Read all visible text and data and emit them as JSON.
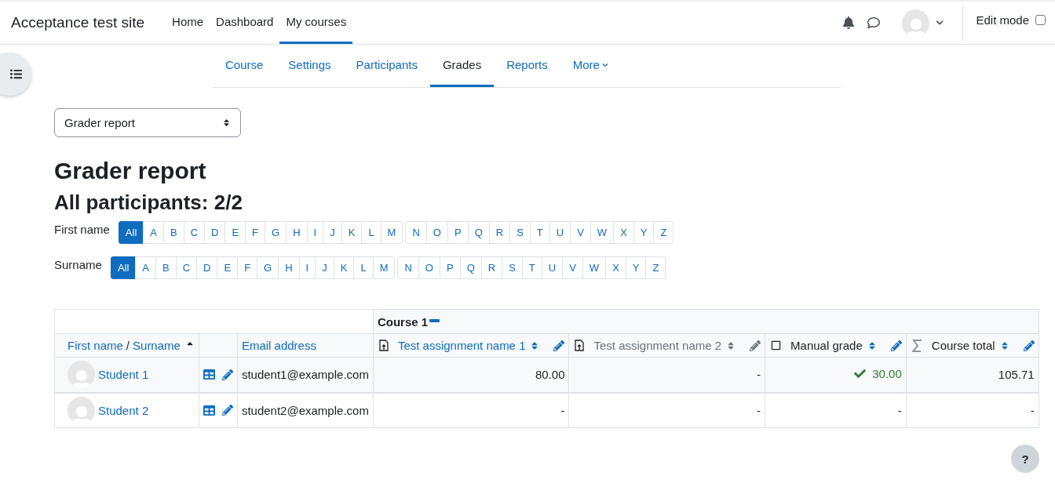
{
  "site_name": "Acceptance test site",
  "primary_nav": [
    {
      "label": "Home",
      "selected": false
    },
    {
      "label": "Dashboard",
      "selected": false
    },
    {
      "label": "My courses",
      "selected": true
    }
  ],
  "edit_mode": {
    "label": "Edit mode",
    "checked": false
  },
  "secondary_nav": [
    {
      "label": "Course",
      "selected": false,
      "dropdown": false
    },
    {
      "label": "Settings",
      "selected": false,
      "dropdown": false
    },
    {
      "label": "Participants",
      "selected": false,
      "dropdown": false
    },
    {
      "label": "Grades",
      "selected": true,
      "dropdown": false
    },
    {
      "label": "Reports",
      "selected": false,
      "dropdown": false
    },
    {
      "label": "More",
      "selected": false,
      "dropdown": true
    }
  ],
  "report_select": {
    "value": "Grader report"
  },
  "title": "Grader report",
  "subtitle": "All participants: 2/2",
  "filters": [
    {
      "label": "First name",
      "letters": [
        {
          "label": "All",
          "selected": true
        },
        {
          "label": "A",
          "selected": false
        },
        {
          "label": "B",
          "selected": false
        },
        {
          "label": "C",
          "selected": false
        },
        {
          "label": "D",
          "selected": false
        },
        {
          "label": "E",
          "selected": false
        },
        {
          "label": "F",
          "selected": false
        },
        {
          "label": "G",
          "selected": false
        },
        {
          "label": "H",
          "selected": false
        },
        {
          "label": "I",
          "selected": false
        },
        {
          "label": "J",
          "selected": false
        },
        {
          "label": "K",
          "selected": false
        },
        {
          "label": "L",
          "selected": false
        },
        {
          "label": "M",
          "selected": false
        },
        {
          "label": "N",
          "selected": false
        },
        {
          "label": "O",
          "selected": false
        },
        {
          "label": "P",
          "selected": false
        },
        {
          "label": "Q",
          "selected": false
        },
        {
          "label": "R",
          "selected": false
        },
        {
          "label": "S",
          "selected": false
        },
        {
          "label": "T",
          "selected": false
        },
        {
          "label": "U",
          "selected": false
        },
        {
          "label": "V",
          "selected": false
        },
        {
          "label": "W",
          "selected": false
        },
        {
          "label": "X",
          "selected": false
        },
        {
          "label": "Y",
          "selected": false
        },
        {
          "label": "Z",
          "selected": false
        }
      ]
    },
    {
      "label": "Surname",
      "letters": [
        {
          "label": "All",
          "selected": true
        },
        {
          "label": "A",
          "selected": false
        },
        {
          "label": "B",
          "selected": false
        },
        {
          "label": "C",
          "selected": false
        },
        {
          "label": "D",
          "selected": false
        },
        {
          "label": "E",
          "selected": false
        },
        {
          "label": "F",
          "selected": false
        },
        {
          "label": "G",
          "selected": false
        },
        {
          "label": "H",
          "selected": false
        },
        {
          "label": "I",
          "selected": false
        },
        {
          "label": "J",
          "selected": false
        },
        {
          "label": "K",
          "selected": false
        },
        {
          "label": "L",
          "selected": false
        },
        {
          "label": "M",
          "selected": false
        },
        {
          "label": "N",
          "selected": false
        },
        {
          "label": "O",
          "selected": false
        },
        {
          "label": "P",
          "selected": false
        },
        {
          "label": "Q",
          "selected": false
        },
        {
          "label": "R",
          "selected": false
        },
        {
          "label": "S",
          "selected": false
        },
        {
          "label": "T",
          "selected": false
        },
        {
          "label": "U",
          "selected": false
        },
        {
          "label": "V",
          "selected": false
        },
        {
          "label": "W",
          "selected": false
        },
        {
          "label": "X",
          "selected": false
        },
        {
          "label": "Y",
          "selected": false
        },
        {
          "label": "Z",
          "selected": false
        }
      ]
    }
  ],
  "table": {
    "category": "Course 1",
    "name_header": {
      "first": "First name",
      "separator": "/",
      "last": "Surname"
    },
    "email_header": "Email address",
    "grade_columns": [
      {
        "kind": "assignment",
        "label": "Test assignment name 1",
        "hidden": false
      },
      {
        "kind": "assignment",
        "label": "Test assignment name 2",
        "hidden": true
      },
      {
        "kind": "manual",
        "label": "Manual grade",
        "hidden": false
      },
      {
        "kind": "total",
        "label": "Course total",
        "hidden": false
      }
    ],
    "rows": [
      {
        "name": "Student 1",
        "email": "student1@example.com",
        "highlighted": true,
        "grades": [
          {
            "value": "80.00",
            "passed": false
          },
          {
            "value": "-",
            "passed": false
          },
          {
            "value": "30.00",
            "passed": true
          },
          {
            "value": "105.71",
            "passed": false
          }
        ]
      },
      {
        "name": "Student 2",
        "email": "student2@example.com",
        "highlighted": false,
        "grades": [
          {
            "value": "-",
            "passed": false
          },
          {
            "value": "-",
            "passed": false
          },
          {
            "value": "-",
            "passed": false
          },
          {
            "value": "-",
            "passed": false
          }
        ]
      }
    ]
  },
  "help_button": "?"
}
